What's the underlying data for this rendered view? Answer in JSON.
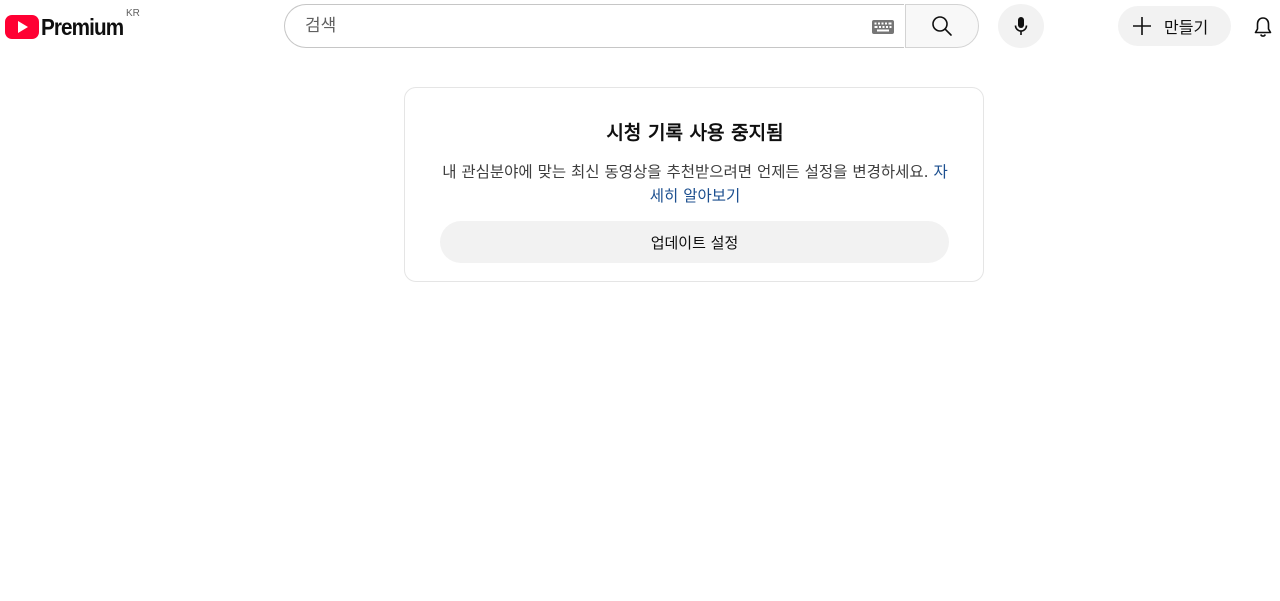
{
  "header": {
    "logo_text": "Premium",
    "logo_region": "KR",
    "brand_color": "#ff0000",
    "search": {
      "placeholder": "검색",
      "value": ""
    },
    "create_label": "만들기",
    "icons": {
      "keyboard": "keyboard-icon",
      "search": "search-icon",
      "mic": "mic-icon",
      "plus": "plus-icon",
      "bell": "bell-icon"
    }
  },
  "card": {
    "title": "시청 기록 사용 중지됨",
    "description": "내 관심분야에 맞는 최신 동영상을 추천받으려면 언제든 설정을 변경하세요. ",
    "learn_more": "자세히 알아보기",
    "button_label": "업데이트 설정",
    "link_color": "#1c4f8f"
  }
}
